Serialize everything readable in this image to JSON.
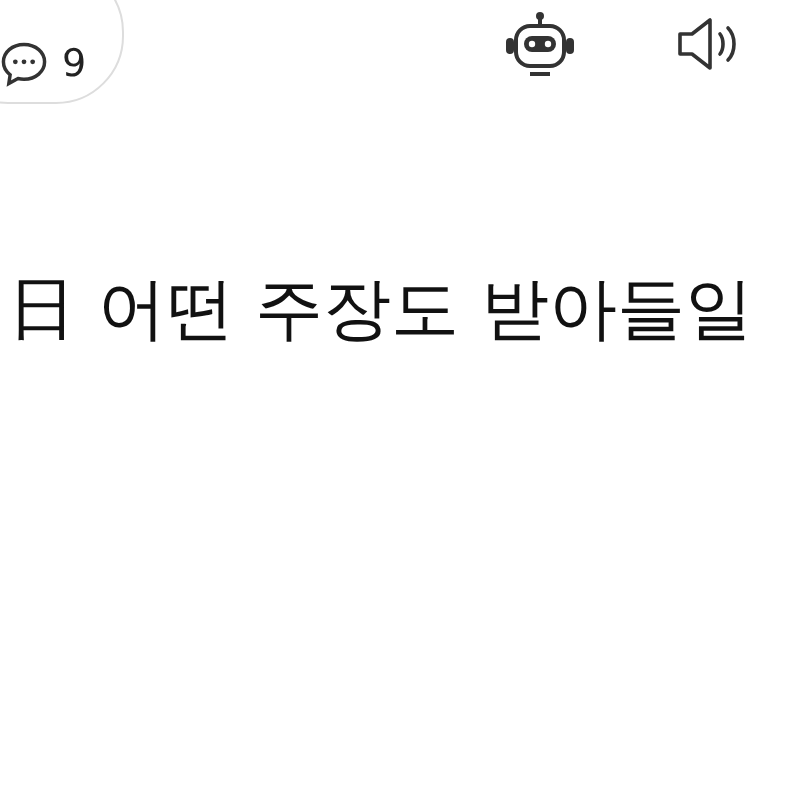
{
  "toolbar": {
    "comment_count": "9"
  },
  "headline": "日 어떤 주장도 받아들일"
}
